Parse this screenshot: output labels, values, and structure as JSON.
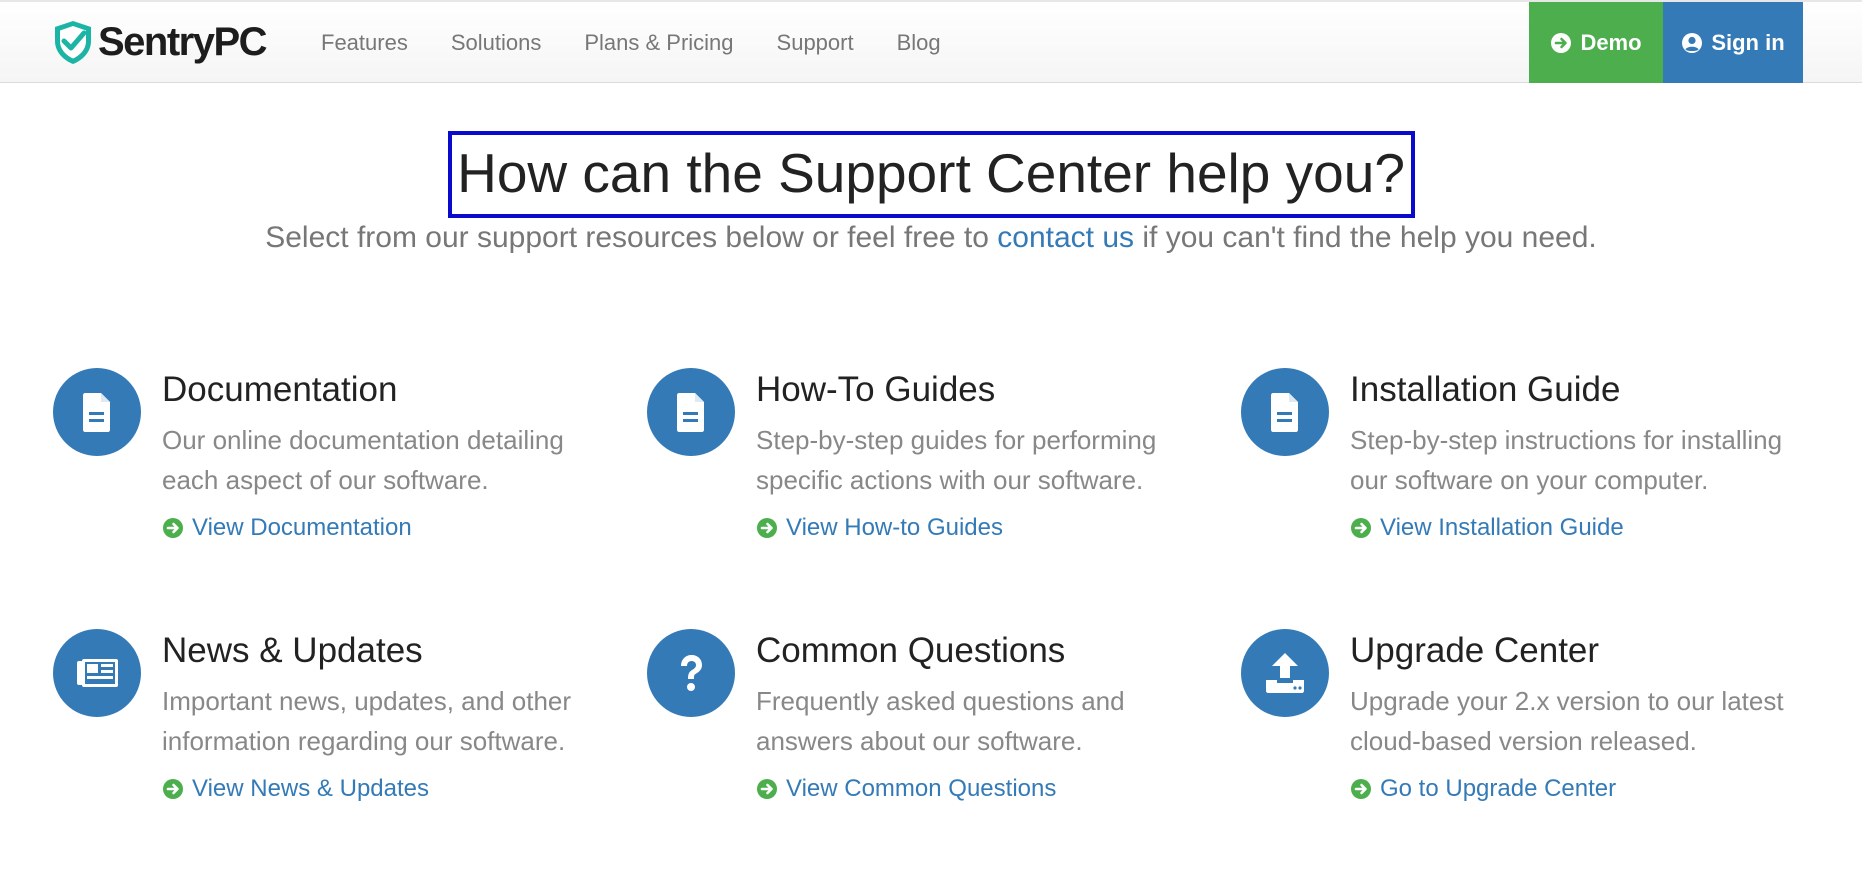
{
  "nav": {
    "brand": "SentryPC",
    "links": [
      "Features",
      "Solutions",
      "Plans & Pricing",
      "Support",
      "Blog"
    ],
    "demo_label": "Demo",
    "signin_label": "Sign in"
  },
  "hero": {
    "title": "How can the Support Center help you?",
    "sub_before": "Select from our support resources below or feel free to",
    "sub_link": "contact us",
    "sub_after": "if you can't find the help you need."
  },
  "cards": [
    {
      "title": "Documentation",
      "desc": "Our online documentation detailing each aspect of our software.",
      "link": "View Documentation",
      "icon": "document-icon"
    },
    {
      "title": "How-To Guides",
      "desc": "Step-by-step guides for performing specific actions with our software.",
      "link": "View How-to Guides",
      "icon": "document-icon"
    },
    {
      "title": "Installation Guide",
      "desc": "Step-by-step instructions for installing our software on your computer.",
      "link": "View Installation Guide",
      "icon": "document-icon"
    },
    {
      "title": "News & Updates",
      "desc": "Important news, updates, and other information regarding our software.",
      "link": "View News & Updates",
      "icon": "newspaper-icon"
    },
    {
      "title": "Common Questions",
      "desc": "Frequently asked questions and answers about our software.",
      "link": "View Common Questions",
      "icon": "question-icon"
    },
    {
      "title": "Upgrade Center",
      "desc": "Upgrade your 2.x version to our latest cloud-based version released.",
      "link": "Go to Upgrade Center",
      "icon": "upload-icon"
    }
  ],
  "colors": {
    "primary": "#337ab7",
    "demo_green": "#4cae4c",
    "highlight_border": "#0a0acc",
    "logo_teal": "#1cb5a5"
  }
}
